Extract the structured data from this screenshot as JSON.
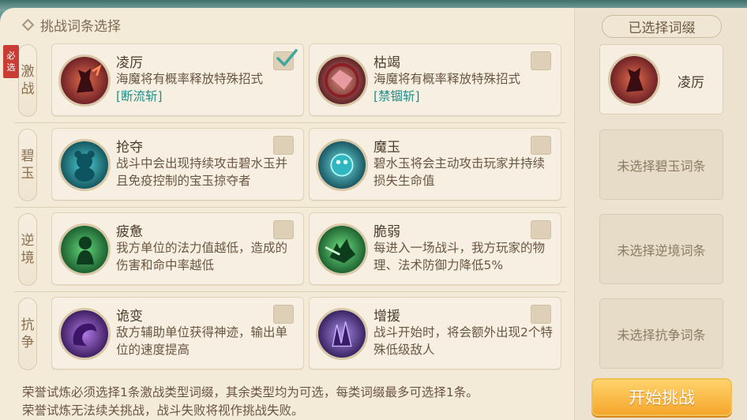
{
  "header": {
    "title": "挑战词条选择"
  },
  "rows": [
    {
      "category": [
        "激",
        "战"
      ],
      "required": [
        "必",
        "选"
      ],
      "cards": [
        {
          "title": "凌厉",
          "desc": "海魔将有概率释放特殊招式",
          "tag": "[断流斩]",
          "checked": true,
          "icon": "red-demon-icon"
        },
        {
          "title": "枯竭",
          "desc": "海魔将有概率释放特殊招式",
          "tag": "[禁锢斩]",
          "checked": false,
          "icon": "red-gem-icon"
        }
      ]
    },
    {
      "category": [
        "碧",
        "玉"
      ],
      "cards": [
        {
          "title": "抢夺",
          "desc": "战斗中会出现持续攻击碧水玉并且免疫控制的宝玉掠夺者",
          "checked": false,
          "icon": "teal-bear-icon"
        },
        {
          "title": "魔玉",
          "desc": "碧水玉将会主动攻击玩家并持续损失生命值",
          "checked": false,
          "icon": "teal-orb-icon"
        }
      ]
    },
    {
      "category": [
        "逆",
        "境"
      ],
      "cards": [
        {
          "title": "疲惫",
          "desc": "我方单位的法力值越低，造成的伤害和命中率越低",
          "checked": false,
          "icon": "green-figure-icon"
        },
        {
          "title": "脆弱",
          "desc": "每进入一场战斗，我方玩家的物理、法术防御力降低5%",
          "checked": false,
          "icon": "green-cat-icon"
        }
      ]
    },
    {
      "category": [
        "抗",
        "争"
      ],
      "cards": [
        {
          "title": "诡变",
          "desc": "敌方辅助单位获得神迹，输出单位的速度提高",
          "checked": false,
          "icon": "purple-swirl-icon"
        },
        {
          "title": "增援",
          "desc": "战斗开始时，将会额外出现2个特殊低级敌人",
          "checked": false,
          "icon": "purple-crystal-icon"
        }
      ]
    }
  ],
  "selected": {
    "title": "已选择词缀",
    "items": [
      {
        "label": "凌厉",
        "filled": true
      },
      {
        "label": "未选择碧玉词条",
        "filled": false
      },
      {
        "label": "未选择逆境词条",
        "filled": false
      },
      {
        "label": "未选择抗争词条",
        "filled": false
      }
    ]
  },
  "footer": {
    "line1": "荣誉试炼必须选择1条激战类型词缀，其余类型均为可选，每类词缀最多可选择1条。",
    "line2": "荣誉试炼无法续关挑战，战斗失败将视作挑战失败。"
  },
  "start_button": "开始挑战",
  "colors": {
    "accent": "#1f8e88",
    "required": "#c93d34",
    "start": "#f5a62c"
  }
}
